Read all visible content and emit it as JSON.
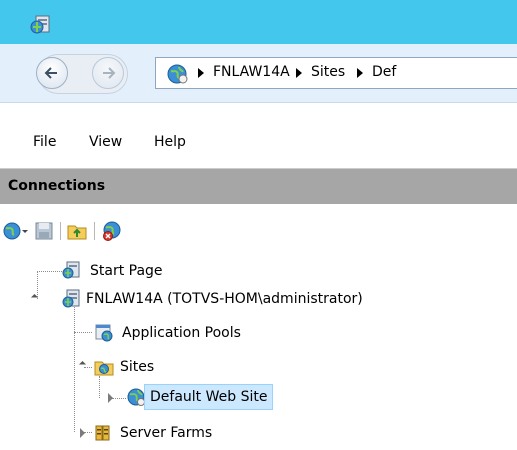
{
  "window": {
    "icon": "iis-manager-icon"
  },
  "navigation": {
    "back_icon": "back-arrow-icon",
    "forward_icon": "forward-arrow-icon",
    "address_icon": "globe-icon",
    "breadcrumbs": [
      "FNLAW14A",
      "Sites",
      "Def"
    ]
  },
  "menu": {
    "file": "File",
    "view": "View",
    "help": "Help"
  },
  "connections": {
    "title": "Connections",
    "toolbar": [
      "connect-icon",
      "save-icon",
      "up-folder-icon",
      "disconnect-icon"
    ]
  },
  "tree": {
    "start_page": "Start Page",
    "server": "FNLAW14A (TOTVS-HOM\\administrator)",
    "app_pools": "Application Pools",
    "sites": "Sites",
    "default_site": "Default Web Site",
    "server_farms": "Server Farms"
  }
}
